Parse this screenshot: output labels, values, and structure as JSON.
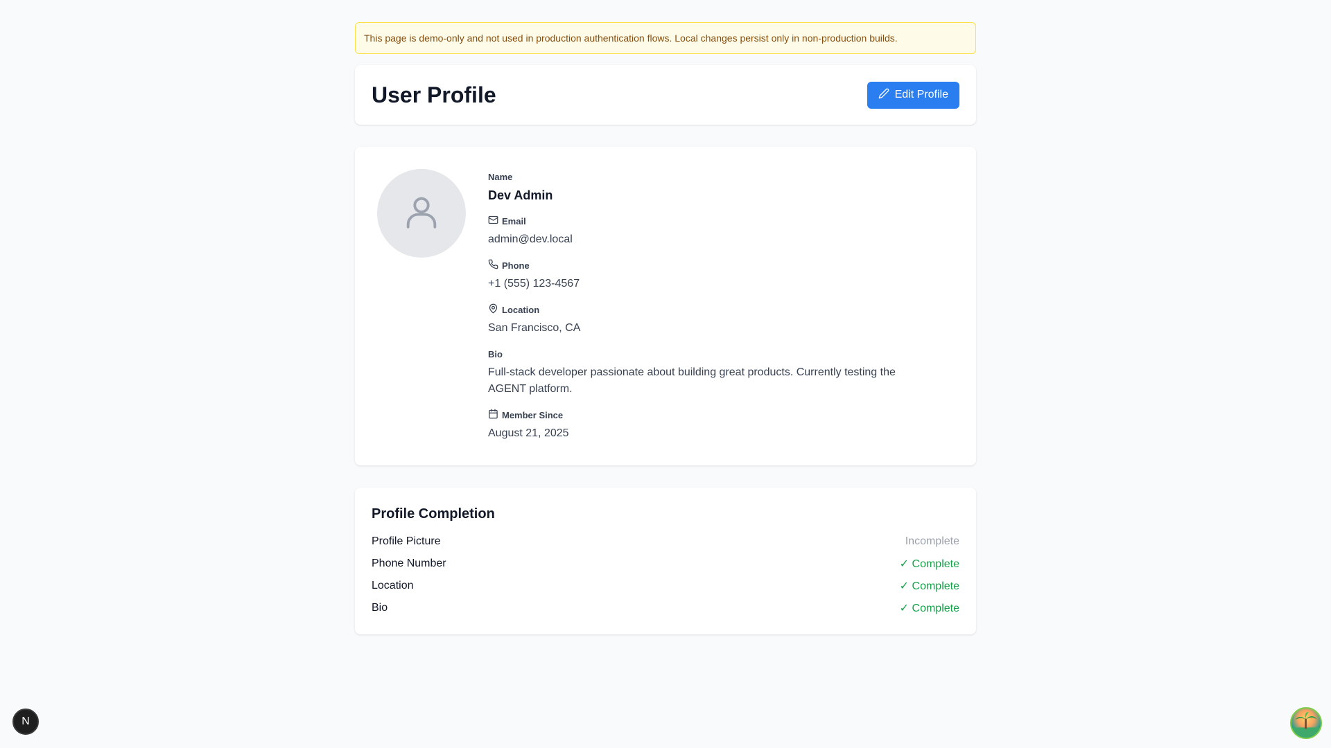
{
  "notice": {
    "text": "This page is demo-only and not used in production authentication flows. Local changes persist only in non-production builds."
  },
  "header": {
    "title": "User Profile",
    "edit_button_label": "Edit Profile",
    "edit_button_icon": "pencil-icon",
    "accent_color": "#2b7ef0"
  },
  "profile": {
    "avatar_icon": "user-icon",
    "name_label": "Name",
    "name_value": "Dev Admin",
    "email_label": "Email",
    "email_icon": "mail-icon",
    "email_value": "admin@dev.local",
    "phone_label": "Phone",
    "phone_icon": "phone-icon",
    "phone_value": "+1 (555) 123-4567",
    "location_label": "Location",
    "location_icon": "map-pin-icon",
    "location_value": "San Francisco, CA",
    "bio_label": "Bio",
    "bio_value": "Full-stack developer passionate about building great products. Currently testing the AGENT platform.",
    "member_since_label": "Member Since",
    "member_since_icon": "calendar-icon",
    "member_since_value": "August 21, 2025"
  },
  "completion": {
    "title": "Profile Completion",
    "items": [
      {
        "label": "Profile Picture",
        "status": "Incomplete",
        "complete": false
      },
      {
        "label": "Phone Number",
        "status": "✓ Complete",
        "complete": true
      },
      {
        "label": "Location",
        "status": "✓ Complete",
        "complete": true
      },
      {
        "label": "Bio",
        "status": "✓ Complete",
        "complete": true
      }
    ],
    "complete_color": "#16a34a",
    "incomplete_color": "#9ca3af"
  },
  "corner": {
    "dev_badge_letter": "N"
  }
}
